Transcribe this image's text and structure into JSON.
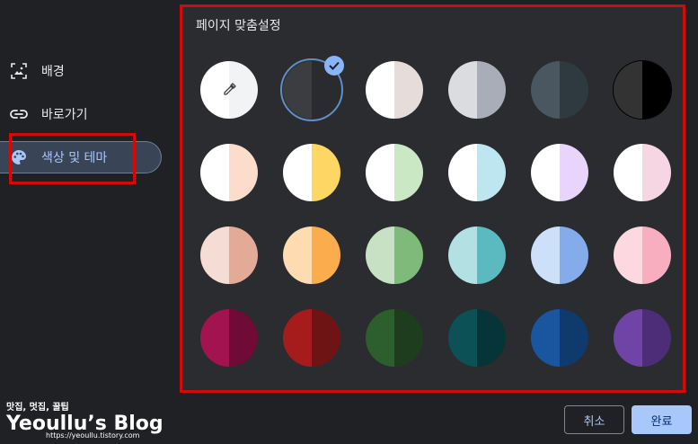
{
  "sidebar": {
    "items": [
      {
        "label": "배경",
        "icon": "background-image-icon",
        "active": false
      },
      {
        "label": "바로가기",
        "icon": "link-icon",
        "active": false
      },
      {
        "label": "색상 및 테마",
        "icon": "palette-icon",
        "active": true
      }
    ]
  },
  "panel": {
    "title": "페이지 맞춤설정",
    "selected_index": 1
  },
  "swatches": [
    {
      "left": "#ffffff",
      "right": "#f1f3f4",
      "icon": "eyedropper-icon"
    },
    {
      "left": "#3c3d40",
      "right": "#2a2b2e",
      "selected": true
    },
    {
      "left": "#ffffff",
      "right": "#e6dcd9"
    },
    {
      "left": "#dadce0",
      "right": "#a9adb8"
    },
    {
      "left": "#4a5761",
      "right": "#2f3940"
    },
    {
      "left": "#333333",
      "right": "#000000"
    },
    {
      "left": "#ffffff",
      "right": "#fcdcca"
    },
    {
      "left": "#ffffff",
      "right": "#fdd663"
    },
    {
      "left": "#ffffff",
      "right": "#cbe8c5"
    },
    {
      "left": "#ffffff",
      "right": "#bde6f1"
    },
    {
      "left": "#ffffff",
      "right": "#e8d4fc"
    },
    {
      "left": "#ffffff",
      "right": "#f7d6e4"
    },
    {
      "left": "#f5ddd5",
      "right": "#e4aa98"
    },
    {
      "left": "#fedbb1",
      "right": "#fbac4c"
    },
    {
      "left": "#c7e1c5",
      "right": "#7ebb7a"
    },
    {
      "left": "#b3e0e2",
      "right": "#5bbac0"
    },
    {
      "left": "#cde0f9",
      "right": "#85acea"
    },
    {
      "left": "#fdd8e0",
      "right": "#f9aebf"
    },
    {
      "left": "#a3134f",
      "right": "#6f0b36"
    },
    {
      "left": "#a61c1c",
      "right": "#6f1414"
    },
    {
      "left": "#2d5e2d",
      "right": "#1e3d1e"
    },
    {
      "left": "#0b5156",
      "right": "#063438"
    },
    {
      "left": "#1a55a0",
      "right": "#0f3a6e"
    },
    {
      "left": "#7043a6",
      "right": "#4d2d78"
    }
  ],
  "buttons": {
    "cancel": "취소",
    "done": "완료"
  },
  "watermark": {
    "subtitle": "맛집, 멋집, 꿀팁",
    "title": "Yeoullu’s Blog",
    "url": "https://yeoullu.tistory.com"
  },
  "colors": {
    "highlight": "#d20a0a",
    "accent": "#a8c7fa"
  }
}
